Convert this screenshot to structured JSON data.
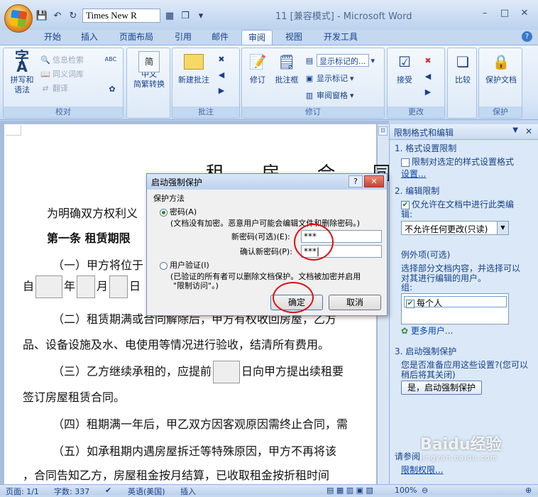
{
  "window": {
    "title": "11 [兼容模式] - Microsoft Word",
    "font_box": "Times New R",
    "controls": [
      "–",
      "□",
      "✕"
    ]
  },
  "tabs": [
    {
      "label": "开始"
    },
    {
      "label": "插入"
    },
    {
      "label": "页面布局"
    },
    {
      "label": "引用"
    },
    {
      "label": "邮件"
    },
    {
      "label": "审阅"
    },
    {
      "label": "视图"
    },
    {
      "label": "开发工具"
    }
  ],
  "ribbon": {
    "proofing": {
      "label": "校对",
      "spell": "拼写和\n语法",
      "research": "信息检索",
      "thesaurus": "同义词库",
      "translate": "翻译"
    },
    "chinese": {
      "label": "中文\n简繁转换"
    },
    "comments": {
      "label": "批注",
      "new": "新建批注"
    },
    "tracking": {
      "label": "修订",
      "track": "修订",
      "balloons": "批注框",
      "markup_dd": "显示标记的...",
      "show_markup": "显示标记",
      "reviewing_pane": "审阅窗格"
    },
    "changes": {
      "label": "更改",
      "accept": "接受"
    },
    "compare": {
      "label": "比较"
    },
    "protect": {
      "label": "保护",
      "doc": "保护文档"
    }
  },
  "document": {
    "title": "租 房 合 同",
    "lines": [
      "为明确双方权利义",
      "第一条 租赁期限",
      "（一）甲方将位于",
      "自",
      "年",
      "月",
      "日",
      "（二）租赁期满或合同解除后，甲方有权收回房屋，乙方",
      "品、设备设施及水、电使用等情况进行验收，结清所有费用。",
      "（三）乙方继续承租的，应提前",
      "日向甲方提出续租要",
      "签订房屋租赁合同。",
      "（四）租期满一年后，甲乙双方因客观原因需终止合同，需",
      "（五）如承租期内遇房屋拆迁等特殊原因，甲方不再将该",
      "，合同告知乙方，房屋租金按月结算，已收取租金按折租时间"
    ]
  },
  "panel": {
    "title": "限制格式和编辑",
    "s1": "1. 格式设置限制",
    "s1_check": "限制对选定的样式设置格式",
    "s1_link": "设置...",
    "s2": "2. 编辑限制",
    "s2_check": "仅允许在文档中进行此类编辑:",
    "s2_select": "不允许任何更改(只读)",
    "exceptions": "例外项(可选)",
    "exceptions_desc": "选择部分文档内容，并选择可以对其进行编辑的用户。",
    "group_label": "组:",
    "group_item": "每个人",
    "more_users": "更多用户...",
    "s3": "3. 启动强制保护",
    "s3_desc": "您是否准备应用这些设置?(您可以稍后将其关闭)",
    "s3_button": "是，启动强制保护",
    "see_also": "请参阅",
    "restrict_link": "限制权限..."
  },
  "dialog": {
    "title": "启动强制保护",
    "method": "保护方法",
    "opt_password": "密码(A)",
    "opt_password_desc": "(文档没有加密。恶意用户可能会编辑文件和删除密码。)",
    "new_pw_label": "新密码(可选)(E):",
    "new_pw": "***",
    "confirm_label": "确认新密码(P):",
    "confirm_pw": "***|",
    "opt_user": "用户验证(I)",
    "opt_user_desc1": "(已验证的所有者可以删除文档保护。文档被加密并启用",
    "opt_user_desc2": "\"限制访问\"。)",
    "ok": "确定",
    "cancel": "取消",
    "help": "?",
    "close": "✕"
  },
  "status": {
    "page": "页面: 1/1",
    "words": "字数: 337",
    "lang": "英语(美国)",
    "mode": "插入",
    "zoom": "100%"
  },
  "watermark": {
    "text": "Baidu经验",
    "sub": "jingyan.baidu.com"
  },
  "colors": {
    "accent": "#15428b",
    "highlight_ring": "#e01010",
    "tab_bg": "#c4d8f0"
  }
}
